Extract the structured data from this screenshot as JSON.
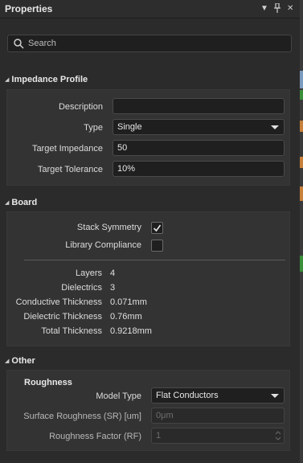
{
  "panel": {
    "title": "Properties",
    "icons": {
      "menu": "chevron-down-icon",
      "pin": "pin-icon",
      "close": "close-icon"
    }
  },
  "search": {
    "placeholder": "Search"
  },
  "impedance_profile": {
    "heading": "Impedance Profile",
    "description_label": "Description",
    "description_value": "",
    "type_label": "Type",
    "type_value": "Single",
    "target_impedance_label": "Target Impedance",
    "target_impedance_value": "50",
    "target_tolerance_label": "Target Tolerance",
    "target_tolerance_value": "10%"
  },
  "board": {
    "heading": "Board",
    "stack_symmetry_label": "Stack Symmetry",
    "stack_symmetry_checked": true,
    "library_compliance_label": "Library Compliance",
    "library_compliance_checked": false,
    "stats": [
      {
        "label": "Layers",
        "value": "4"
      },
      {
        "label": "Dielectrics",
        "value": "3"
      },
      {
        "label": "Conductive Thickness",
        "value": "0.071mm"
      },
      {
        "label": "Dielectric Thickness",
        "value": "0.76mm"
      },
      {
        "label": "Total Thickness",
        "value": "0.9218mm"
      }
    ]
  },
  "other": {
    "heading": "Other",
    "roughness_heading": "Roughness",
    "model_type_label": "Model Type",
    "model_type_value": "Flat Conductors",
    "surface_roughness_label": "Surface Roughness (SR) [um]",
    "surface_roughness_value": "0μm",
    "roughness_factor_label": "Roughness Factor (RF)",
    "roughness_factor_value": "1"
  },
  "colors": {
    "background": "#2b2b2b",
    "panel": "#333333",
    "field": "#1f1f1f",
    "edge_green": "#3a8f3a",
    "edge_orange": "#c8803a"
  }
}
